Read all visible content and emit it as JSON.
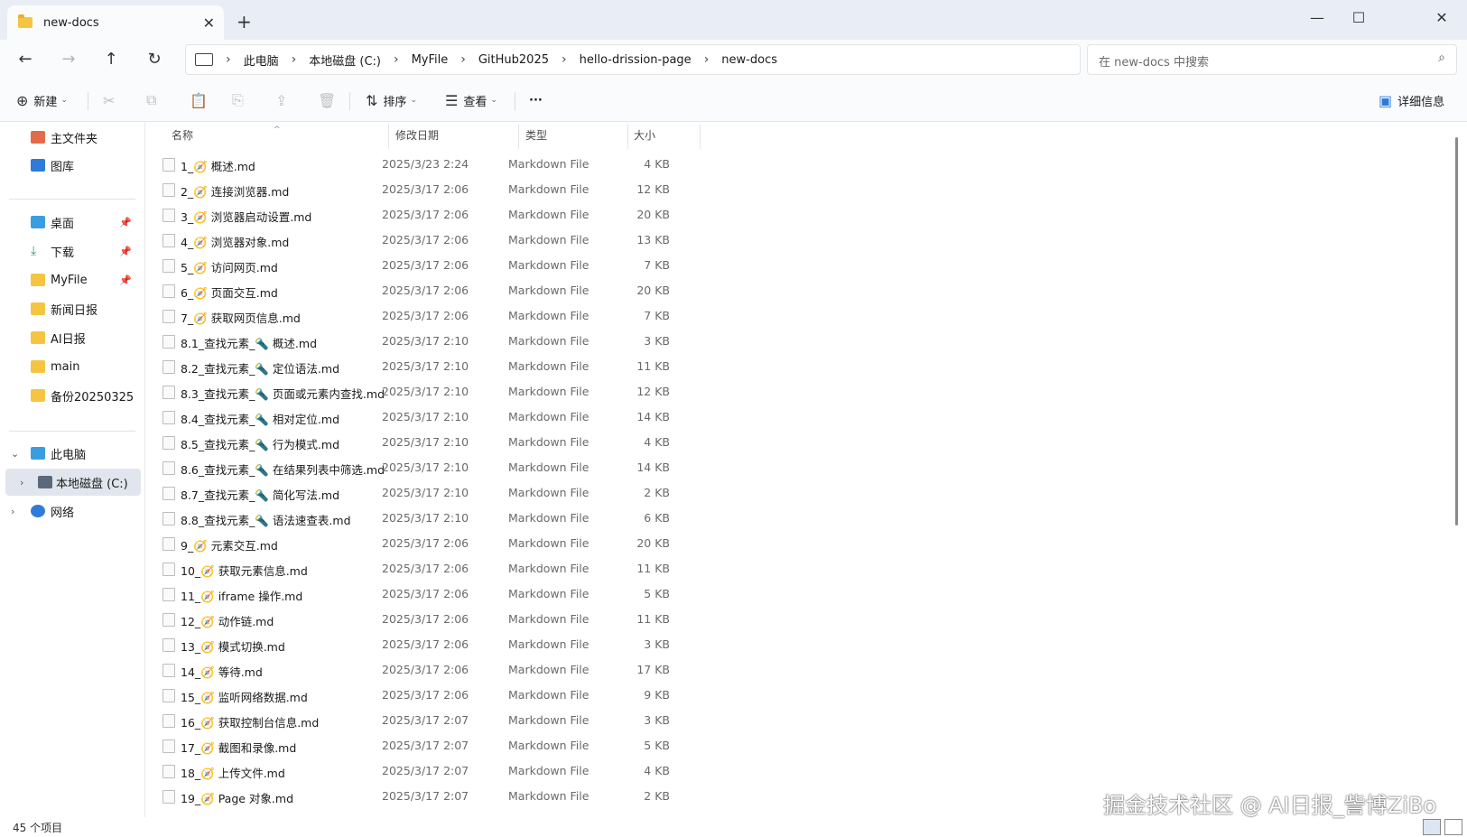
{
  "window": {
    "tab_title": "new-docs",
    "tab_close": "✕",
    "new_tab": "+",
    "minimize": "—",
    "maximize": "☐",
    "close": "✕"
  },
  "address_bar": {
    "breadcrumbs": [
      "此电脑",
      "本地磁盘 (C:)",
      "MyFile",
      "GitHub2025",
      "hello-drission-page",
      "new-docs"
    ],
    "search_placeholder": "在 new-docs 中搜索"
  },
  "toolbar": {
    "new_label": "新建",
    "sort_label": "排序",
    "view_label": "查看",
    "more_label": "···",
    "details_label": "详细信息"
  },
  "sidebar": {
    "quick": [
      {
        "label": "主文件夹",
        "icon": "home-icon"
      },
      {
        "label": "图库",
        "icon": "gallery-icon"
      }
    ],
    "pinned": [
      {
        "label": "桌面",
        "icon": "desktop-icon",
        "pinned": true
      },
      {
        "label": "下载",
        "icon": "download-icon",
        "pinned": true
      },
      {
        "label": "MyFile",
        "icon": "folder-icon",
        "pinned": true
      },
      {
        "label": "新闻日报",
        "icon": "folder-icon",
        "pinned": false
      },
      {
        "label": "AI日报",
        "icon": "folder-icon",
        "pinned": false
      },
      {
        "label": "main",
        "icon": "folder-icon",
        "pinned": false
      },
      {
        "label": "备份20250325",
        "icon": "folder-icon",
        "pinned": false
      }
    ],
    "tree": [
      {
        "label": "此电脑",
        "icon": "pc-icon",
        "expanded": true
      },
      {
        "label": "本地磁盘 (C:)",
        "icon": "disk-icon",
        "selected": true
      },
      {
        "label": "网络",
        "icon": "network-icon",
        "expanded": false
      }
    ]
  },
  "columns": {
    "name": "名称",
    "date": "修改日期",
    "type": "类型",
    "size": "大小"
  },
  "files": [
    {
      "name": "1_🧭 概述.md",
      "date": "2025/3/23 2:24",
      "type": "Markdown File",
      "size": "4 KB"
    },
    {
      "name": "2_🧭 连接浏览器.md",
      "date": "2025/3/17 2:06",
      "type": "Markdown File",
      "size": "12 KB"
    },
    {
      "name": "3_🧭 浏览器启动设置.md",
      "date": "2025/3/17 2:06",
      "type": "Markdown File",
      "size": "20 KB"
    },
    {
      "name": "4_🧭 浏览器对象.md",
      "date": "2025/3/17 2:06",
      "type": "Markdown File",
      "size": "13 KB"
    },
    {
      "name": "5_🧭 访问网页.md",
      "date": "2025/3/17 2:06",
      "type": "Markdown File",
      "size": "7 KB"
    },
    {
      "name": "6_🧭 页面交互.md",
      "date": "2025/3/17 2:06",
      "type": "Markdown File",
      "size": "20 KB"
    },
    {
      "name": "7_🧭 获取网页信息.md",
      "date": "2025/3/17 2:06",
      "type": "Markdown File",
      "size": "7 KB"
    },
    {
      "name": "8.1_查找元素_🔦 概述.md",
      "date": "2025/3/17 2:10",
      "type": "Markdown File",
      "size": "3 KB"
    },
    {
      "name": "8.2_查找元素_🔦 定位语法.md",
      "date": "2025/3/17 2:10",
      "type": "Markdown File",
      "size": "11 KB"
    },
    {
      "name": "8.3_查找元素_🔦 页面或元素内查找.md",
      "date": "2025/3/17 2:10",
      "type": "Markdown File",
      "size": "12 KB"
    },
    {
      "name": "8.4_查找元素_🔦 相对定位.md",
      "date": "2025/3/17 2:10",
      "type": "Markdown File",
      "size": "14 KB"
    },
    {
      "name": "8.5_查找元素_🔦 行为模式.md",
      "date": "2025/3/17 2:10",
      "type": "Markdown File",
      "size": "4 KB"
    },
    {
      "name": "8.6_查找元素_🔦 在结果列表中筛选.md",
      "date": "2025/3/17 2:10",
      "type": "Markdown File",
      "size": "14 KB"
    },
    {
      "name": "8.7_查找元素_🔦 简化写法.md",
      "date": "2025/3/17 2:10",
      "type": "Markdown File",
      "size": "2 KB"
    },
    {
      "name": "8.8_查找元素_🔦 语法速查表.md",
      "date": "2025/3/17 2:10",
      "type": "Markdown File",
      "size": "6 KB"
    },
    {
      "name": "9_🧭 元素交互.md",
      "date": "2025/3/17 2:06",
      "type": "Markdown File",
      "size": "20 KB"
    },
    {
      "name": "10_🧭 获取元素信息.md",
      "date": "2025/3/17 2:06",
      "type": "Markdown File",
      "size": "11 KB"
    },
    {
      "name": "11_🧭 iframe 操作.md",
      "date": "2025/3/17 2:06",
      "type": "Markdown File",
      "size": "5 KB"
    },
    {
      "name": "12_🧭 动作链.md",
      "date": "2025/3/17 2:06",
      "type": "Markdown File",
      "size": "11 KB"
    },
    {
      "name": "13_🧭 模式切换.md",
      "date": "2025/3/17 2:06",
      "type": "Markdown File",
      "size": "3 KB"
    },
    {
      "name": "14_🧭 等待.md",
      "date": "2025/3/17 2:06",
      "type": "Markdown File",
      "size": "17 KB"
    },
    {
      "name": "15_🧭 监听网络数据.md",
      "date": "2025/3/17 2:06",
      "type": "Markdown File",
      "size": "9 KB"
    },
    {
      "name": "16_🧭 获取控制台信息.md",
      "date": "2025/3/17 2:07",
      "type": "Markdown File",
      "size": "3 KB"
    },
    {
      "name": "17_🧭 截图和录像.md",
      "date": "2025/3/17 2:07",
      "type": "Markdown File",
      "size": "5 KB"
    },
    {
      "name": "18_🧭 上传文件.md",
      "date": "2025/3/17 2:07",
      "type": "Markdown File",
      "size": "4 KB"
    },
    {
      "name": "19_🧭 Page 对象.md",
      "date": "2025/3/17 2:07",
      "type": "Markdown File",
      "size": "2 KB"
    }
  ],
  "status": {
    "item_count": "45 个项目"
  },
  "watermark": "掘金技术社区 @ AI日报_訾博ZiBo"
}
